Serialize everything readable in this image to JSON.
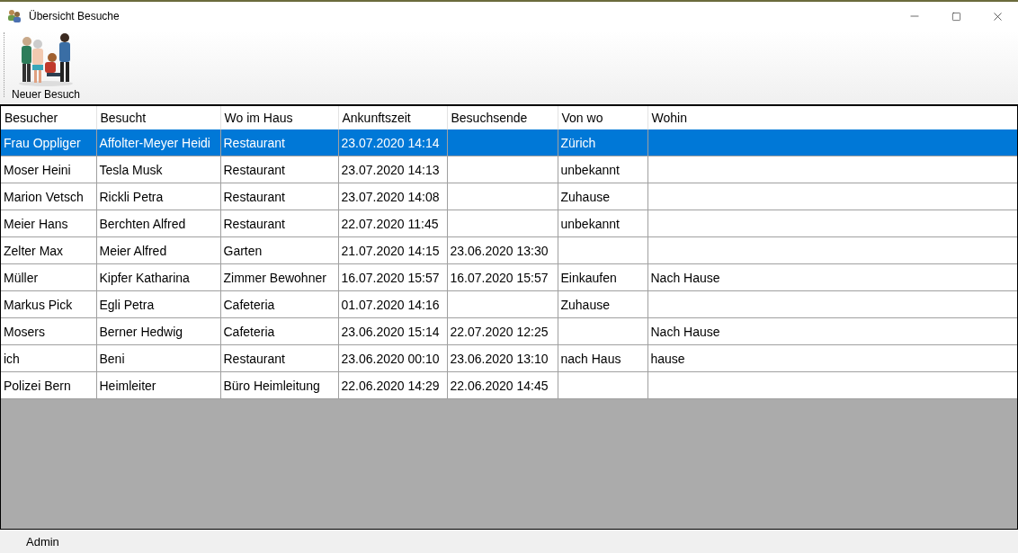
{
  "window": {
    "title": "Übersicht Besuche"
  },
  "toolbar": {
    "buttons": [
      {
        "label": "Neuer Besuch"
      }
    ]
  },
  "table": {
    "columns": [
      "Besucher",
      "Besucht",
      "Wo im Haus",
      "Ankunftszeit",
      "Besuchsende",
      "Von wo",
      "Wohin"
    ],
    "rows": [
      {
        "selected": true,
        "cells": [
          "Frau Oppliger",
          "Affolter-Meyer Heidi",
          "Restaurant",
          "23.07.2020 14:14",
          "",
          "Zürich",
          ""
        ]
      },
      {
        "selected": false,
        "cells": [
          "Moser Heini",
          "Tesla Musk",
          "Restaurant",
          "23.07.2020 14:13",
          "",
          "unbekannt",
          ""
        ]
      },
      {
        "selected": false,
        "cells": [
          "Marion Vetsch",
          "Rickli Petra",
          "Restaurant",
          "23.07.2020 14:08",
          "",
          "Zuhause",
          ""
        ]
      },
      {
        "selected": false,
        "cells": [
          "Meier Hans",
          "Berchten Alfred",
          "Restaurant",
          "22.07.2020 11:45",
          "",
          "unbekannt",
          ""
        ]
      },
      {
        "selected": false,
        "cells": [
          "Zelter Max",
          "Meier Alfred",
          "Garten",
          "21.07.2020 14:15",
          "23.06.2020 13:30",
          "",
          ""
        ]
      },
      {
        "selected": false,
        "cells": [
          "Müller",
          "Kipfer Katharina",
          "Zimmer Bewohner",
          "16.07.2020 15:57",
          "16.07.2020 15:57",
          "Einkaufen",
          "Nach Hause"
        ]
      },
      {
        "selected": false,
        "cells": [
          "Markus Pick",
          "Egli Petra",
          "Cafeteria",
          "01.07.2020 14:16",
          "",
          "Zuhause",
          ""
        ]
      },
      {
        "selected": false,
        "cells": [
          "Mosers",
          "Berner Hedwig",
          "Cafeteria",
          "23.06.2020 15:14",
          "22.07.2020 12:25",
          "",
          "Nach Hause"
        ]
      },
      {
        "selected": false,
        "cells": [
          "ich",
          "Beni",
          "Restaurant",
          "23.06.2020 00:10",
          "23.06.2020 13:10",
          "nach Haus",
          "hause"
        ]
      },
      {
        "selected": false,
        "cells": [
          "Polizei Bern",
          "Heimleiter",
          "Büro Heimleitung",
          "22.06.2020 14:29",
          "22.06.2020 14:45",
          "",
          ""
        ]
      }
    ]
  },
  "status_bar": {
    "user": "Admin"
  }
}
